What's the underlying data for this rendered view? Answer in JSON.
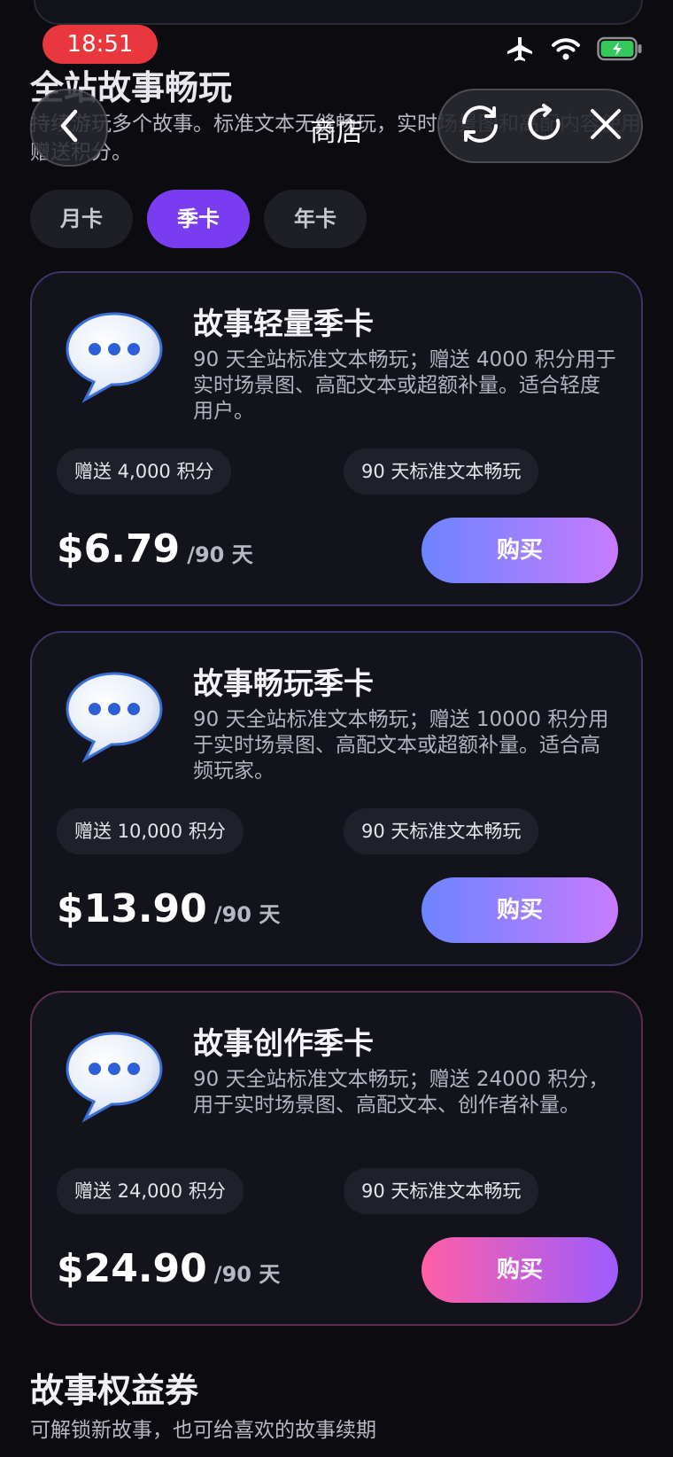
{
  "status_bar": {
    "time": "18:51"
  },
  "nav": {
    "title": "商店"
  },
  "section": {
    "title": "全站故事畅玩",
    "description": "持续游玩多个故事。标准文本无缝畅玩，实时场景图和高配内容使用赠送积分。"
  },
  "tabs": [
    {
      "label": "月卡",
      "active": false
    },
    {
      "label": "季卡",
      "active": true
    },
    {
      "label": "年卡",
      "active": false
    }
  ],
  "plans": [
    {
      "title": "故事轻量季卡",
      "description": "90 天全站标准文本畅玩；赠送 4000 积分用于实时场景图、高配文本或超额补量。适合轻度用户。",
      "chip_points": "赠送 4,000 积分",
      "chip_duration": "90 天标准文本畅玩",
      "price": "$6.79",
      "unit": "/90 天",
      "buy_label": "购买"
    },
    {
      "title": "故事畅玩季卡",
      "description": "90 天全站标准文本畅玩；赠送 10000 积分用于实时场景图、高配文本或超额补量。适合高频玩家。",
      "chip_points": "赠送 10,000 积分",
      "chip_duration": "90 天标准文本畅玩",
      "price": "$13.90",
      "unit": "/90 天",
      "buy_label": "购买"
    },
    {
      "title": "故事创作季卡",
      "description": "90 天全站标准文本畅玩；赠送 24000 积分，用于实时场景图、高配文本、创作者补量。",
      "chip_points": "赠送 24,000 积分",
      "chip_duration": "90 天标准文本畅玩",
      "price": "$24.90",
      "unit": "/90 天",
      "buy_label": "购买"
    }
  ],
  "coupon_section": {
    "title": "故事权益券",
    "description": "可解锁新故事，也可给喜欢的故事续期"
  },
  "colors": {
    "accent": "#7a3cf0",
    "status_time_bg": "#e8383d",
    "buy_gradient": [
      "#6d84ff",
      "#c77bff"
    ],
    "buy_gradient_pink": [
      "#ff5fa6",
      "#9c5cff"
    ],
    "battery_green": "#34c759"
  },
  "icons": [
    "airplane-icon",
    "wifi-icon",
    "battery-charging-icon",
    "chevron-left-icon",
    "sync-icon",
    "reload-icon",
    "close-icon",
    "chat-bubble-icon"
  ]
}
